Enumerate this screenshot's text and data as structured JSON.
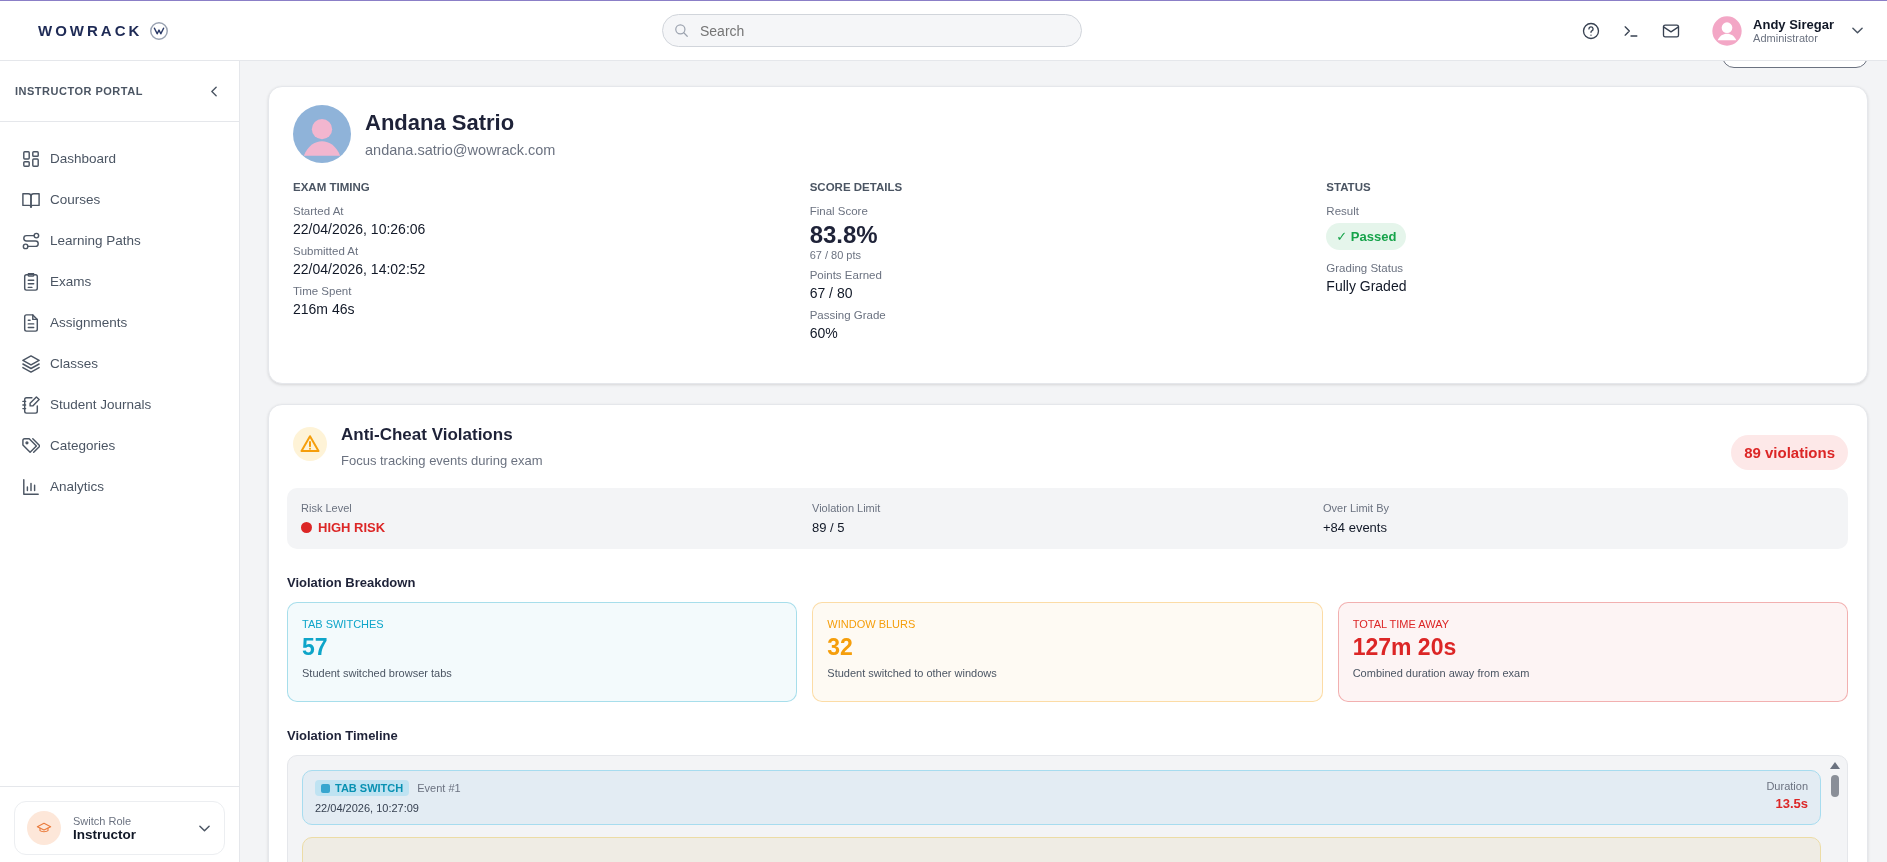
{
  "header": {
    "logo": "WOWRACK",
    "search": {
      "placeholder": "Search"
    },
    "user": {
      "name": "Andy Siregar",
      "role": "Administrator"
    }
  },
  "sidebar": {
    "title": "INSTRUCTOR PORTAL",
    "items": [
      {
        "label": "Dashboard",
        "selected": false
      },
      {
        "label": "Courses",
        "selected": false
      },
      {
        "label": "Learning Paths",
        "selected": false
      },
      {
        "label": "Exams",
        "selected": false
      },
      {
        "label": "Assignments",
        "selected": false
      },
      {
        "label": "Classes",
        "selected": false
      },
      {
        "label": "Student Journals",
        "selected": false
      },
      {
        "label": "Categories",
        "selected": false
      },
      {
        "label": "Analytics",
        "selected": false
      }
    ],
    "switch_role": {
      "label": "Switch Role",
      "value": "Instructor"
    }
  },
  "profile": {
    "name": "Andana Satrio",
    "email": "andana.satrio@wowrack.com",
    "sections": [
      {
        "title": "EXAM TIMING",
        "fields": [
          {
            "kind": "text",
            "label": "Started At",
            "value": "22/04/2026, 10:26:06"
          },
          {
            "kind": "text",
            "label": "Submitted At",
            "value": "22/04/2026, 14:02:52"
          },
          {
            "kind": "text",
            "label": "Time Spent",
            "value": "216m 46s"
          }
        ]
      },
      {
        "title": "SCORE DETAILS",
        "fields": [
          {
            "kind": "score",
            "label": "Final Score",
            "value": "83.8%",
            "sub": "67 / 80 pts"
          },
          {
            "kind": "text",
            "label": "Points Earned",
            "value": "67 / 80"
          },
          {
            "kind": "text",
            "label": "Passing Grade",
            "value": "60%"
          }
        ]
      },
      {
        "title": "STATUS",
        "fields": [
          {
            "kind": "badge",
            "label": "Result",
            "value": "✓ Passed",
            "color": "#16a34a"
          },
          {
            "kind": "text",
            "label": "Grading Status",
            "value": "Fully Graded"
          }
        ]
      }
    ]
  },
  "anti_cheat": {
    "title": "Anti-Cheat Violations",
    "subtitle": "Focus tracking events during exam",
    "count": "89 violations",
    "summary": [
      {
        "kind": "risk",
        "label": "Risk Level",
        "value": "HIGH RISK",
        "color": "#dc2626"
      },
      {
        "kind": "text",
        "label": "Violation Limit",
        "value": "89 / 5"
      },
      {
        "kind": "text",
        "label": "Over Limit By",
        "value": "+84 events"
      }
    ],
    "breakdown_title": "Violation Breakdown",
    "breakdown": [
      {
        "label": "TAB SWITCHES",
        "value": "57",
        "description": "Student switched browser tabs",
        "color": "#0ea5c9"
      },
      {
        "label": "WINDOW BLURS",
        "value": "32",
        "description": "Student switched to other windows",
        "color": "#f59e0b"
      },
      {
        "label": "TOTAL TIME AWAY",
        "value": "127m 20s",
        "description": "Combined duration away from exam",
        "color": "#dc2626"
      }
    ],
    "timeline_title": "Violation Timeline",
    "events": [
      {
        "kind": "tab_switch",
        "type": "TAB SWITCH",
        "event": "Event #1",
        "time": "22/04/2026, 10:27:09",
        "duration_label": "Duration",
        "duration": "13.5s"
      },
      {
        "kind": "window_blur"
      }
    ]
  }
}
